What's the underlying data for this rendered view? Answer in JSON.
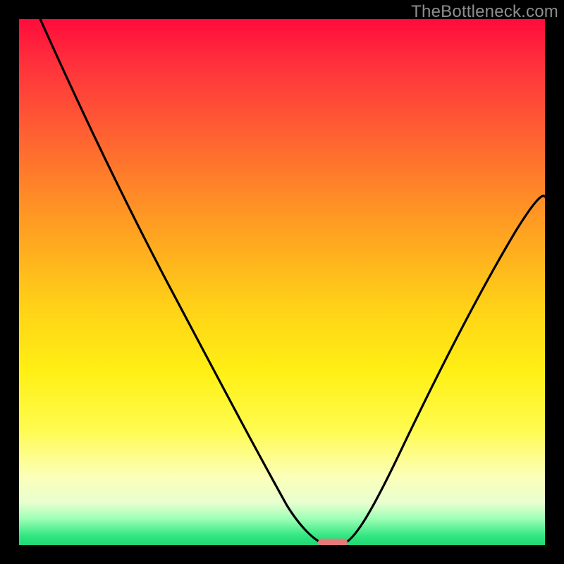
{
  "watermark": {
    "text": "TheBottleneck.com"
  },
  "chart_data": {
    "type": "line",
    "title": "",
    "xlabel": "",
    "ylabel": "",
    "xlim": [
      0.0,
      1.0
    ],
    "ylim": [
      0.0,
      1.0
    ],
    "legend": false,
    "grid": false,
    "background": "gradient_red_to_green_vertical",
    "series": [
      {
        "name": "bottleneck-curve-left",
        "x": [
          0.04,
          0.1,
          0.18,
          0.28,
          0.38,
          0.47,
          0.52,
          0.555,
          0.575
        ],
        "y": [
          1.0,
          0.86,
          0.69,
          0.5,
          0.32,
          0.16,
          0.07,
          0.02,
          0.003
        ]
      },
      {
        "name": "bottleneck-curve-right",
        "x": [
          0.62,
          0.66,
          0.73,
          0.81,
          0.89,
          0.95,
          1.0
        ],
        "y": [
          0.003,
          0.06,
          0.19,
          0.35,
          0.5,
          0.6,
          0.66
        ]
      }
    ],
    "marker": {
      "name": "optimal-range-pill",
      "center_x": 0.595,
      "y": 0.006,
      "width": 0.055,
      "color": "#e67a7a"
    },
    "gradient_stops": [
      {
        "pos_pct": 0,
        "color": "#ff0b3b"
      },
      {
        "pos_pct": 20,
        "color": "#ff5a34"
      },
      {
        "pos_pct": 50,
        "color": "#ffd217"
      },
      {
        "pos_pct": 80,
        "color": "#fcffb8"
      },
      {
        "pos_pct": 100,
        "color": "#1fd874"
      }
    ]
  }
}
